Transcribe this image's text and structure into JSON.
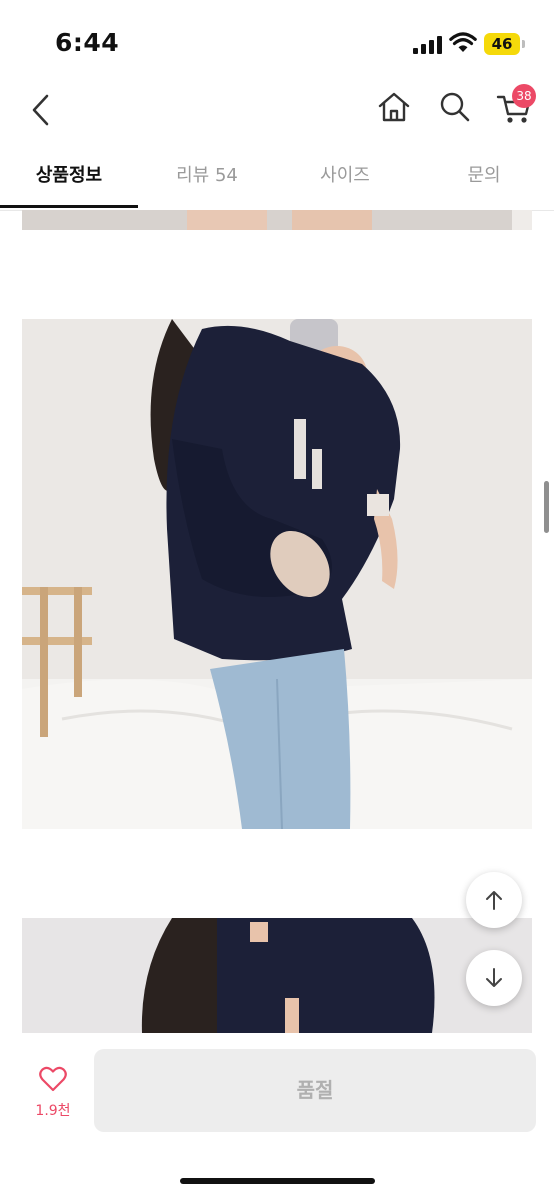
{
  "status_bar": {
    "time": "6:44",
    "battery": "46"
  },
  "header": {
    "cart_count": "38"
  },
  "tabs": [
    {
      "label": "상품정보",
      "active": true
    },
    {
      "label": "리뷰 54",
      "active": false
    },
    {
      "label": "사이즈",
      "active": false
    },
    {
      "label": "문의",
      "active": false
    }
  ],
  "bottom_bar": {
    "like_count": "1.9천",
    "buy_label": "품절"
  },
  "colors": {
    "accent": "#ec4966",
    "battery": "#f5d90a"
  },
  "icons": [
    "back-icon",
    "home-icon",
    "search-icon",
    "cart-icon",
    "heart-icon",
    "arrow-up-icon",
    "arrow-down-icon"
  ]
}
